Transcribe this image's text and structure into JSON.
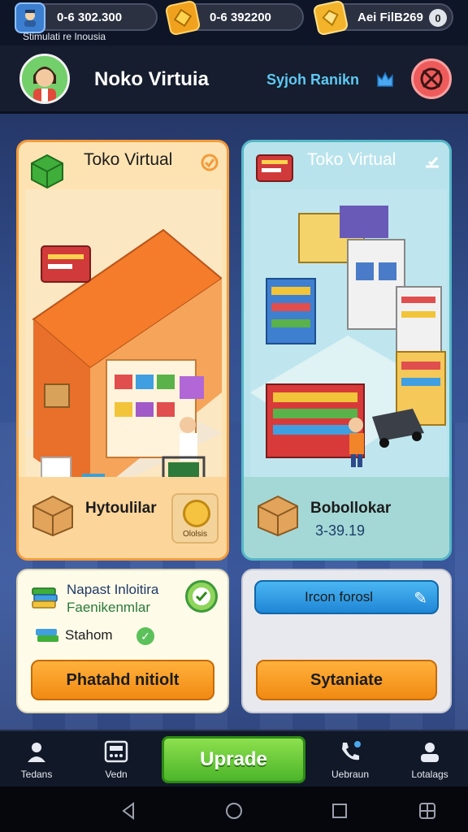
{
  "statusbar": {
    "resources": [
      {
        "icon": "profile-badge-icon",
        "value": "0-6 302.300"
      },
      {
        "icon": "gold-coin-icon",
        "value": "0-6 392200"
      },
      {
        "icon": "gem-icon",
        "value": "Aei FilB269"
      }
    ],
    "end_glyph": "0",
    "subtitle": "Stimulati re Inousia"
  },
  "header": {
    "title": "Noko Virtuia",
    "rank_label": "Syjoh Ranikn"
  },
  "cards": {
    "left": {
      "title": "Toko Virtual",
      "footer_label": "Hytoulilar",
      "badge_label": "Ololsis"
    },
    "right": {
      "title": "Toko Virtual",
      "footer_label": "Bobollokar",
      "footer_value": "3-39.19"
    }
  },
  "panels": {
    "left": {
      "line1": "Napast Inloitira",
      "line2": "Faenikenmlar",
      "line3": "Stahom",
      "button": "Phatahd nitiolt"
    },
    "right": {
      "input_label": "Ircon forosl",
      "button": "Sytaniate"
    }
  },
  "nav": {
    "items": [
      {
        "label": "Tedans",
        "icon": "person-icon"
      },
      {
        "label": "Vedn",
        "icon": "register-icon"
      },
      {
        "label": "Uebraun",
        "icon": "phone-icon"
      },
      {
        "label": "Lotalags",
        "icon": "profile-icon"
      }
    ],
    "upgrade": "Uprade"
  },
  "colors": {
    "accent_green": "#4cb52a",
    "accent_orange": "#f18a12",
    "accent_blue": "#1f86d6",
    "left_card_border": "#f39b3a",
    "right_card_border": "#55b7c6"
  }
}
